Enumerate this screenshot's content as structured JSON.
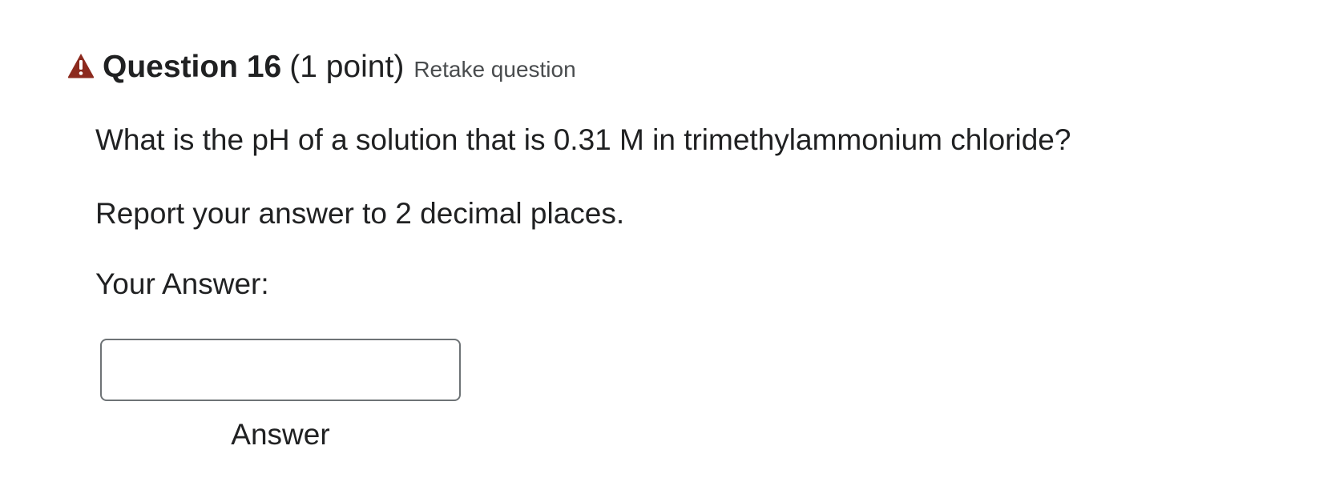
{
  "question": {
    "title": "Question 16",
    "points": "(1 point)",
    "retake_label": "Retake question",
    "status_icon": "warning-triangle-icon",
    "status_color": "#8c2a1e",
    "prompt_lines": [
      "What is the pH of a solution that is 0.31 M in trimethylammonium chloride?",
      "Report your answer to 2 decimal places."
    ],
    "answer_label": "Your Answer:",
    "answer_input": {
      "value": "",
      "placeholder": ""
    },
    "answer_caption": "Answer"
  }
}
